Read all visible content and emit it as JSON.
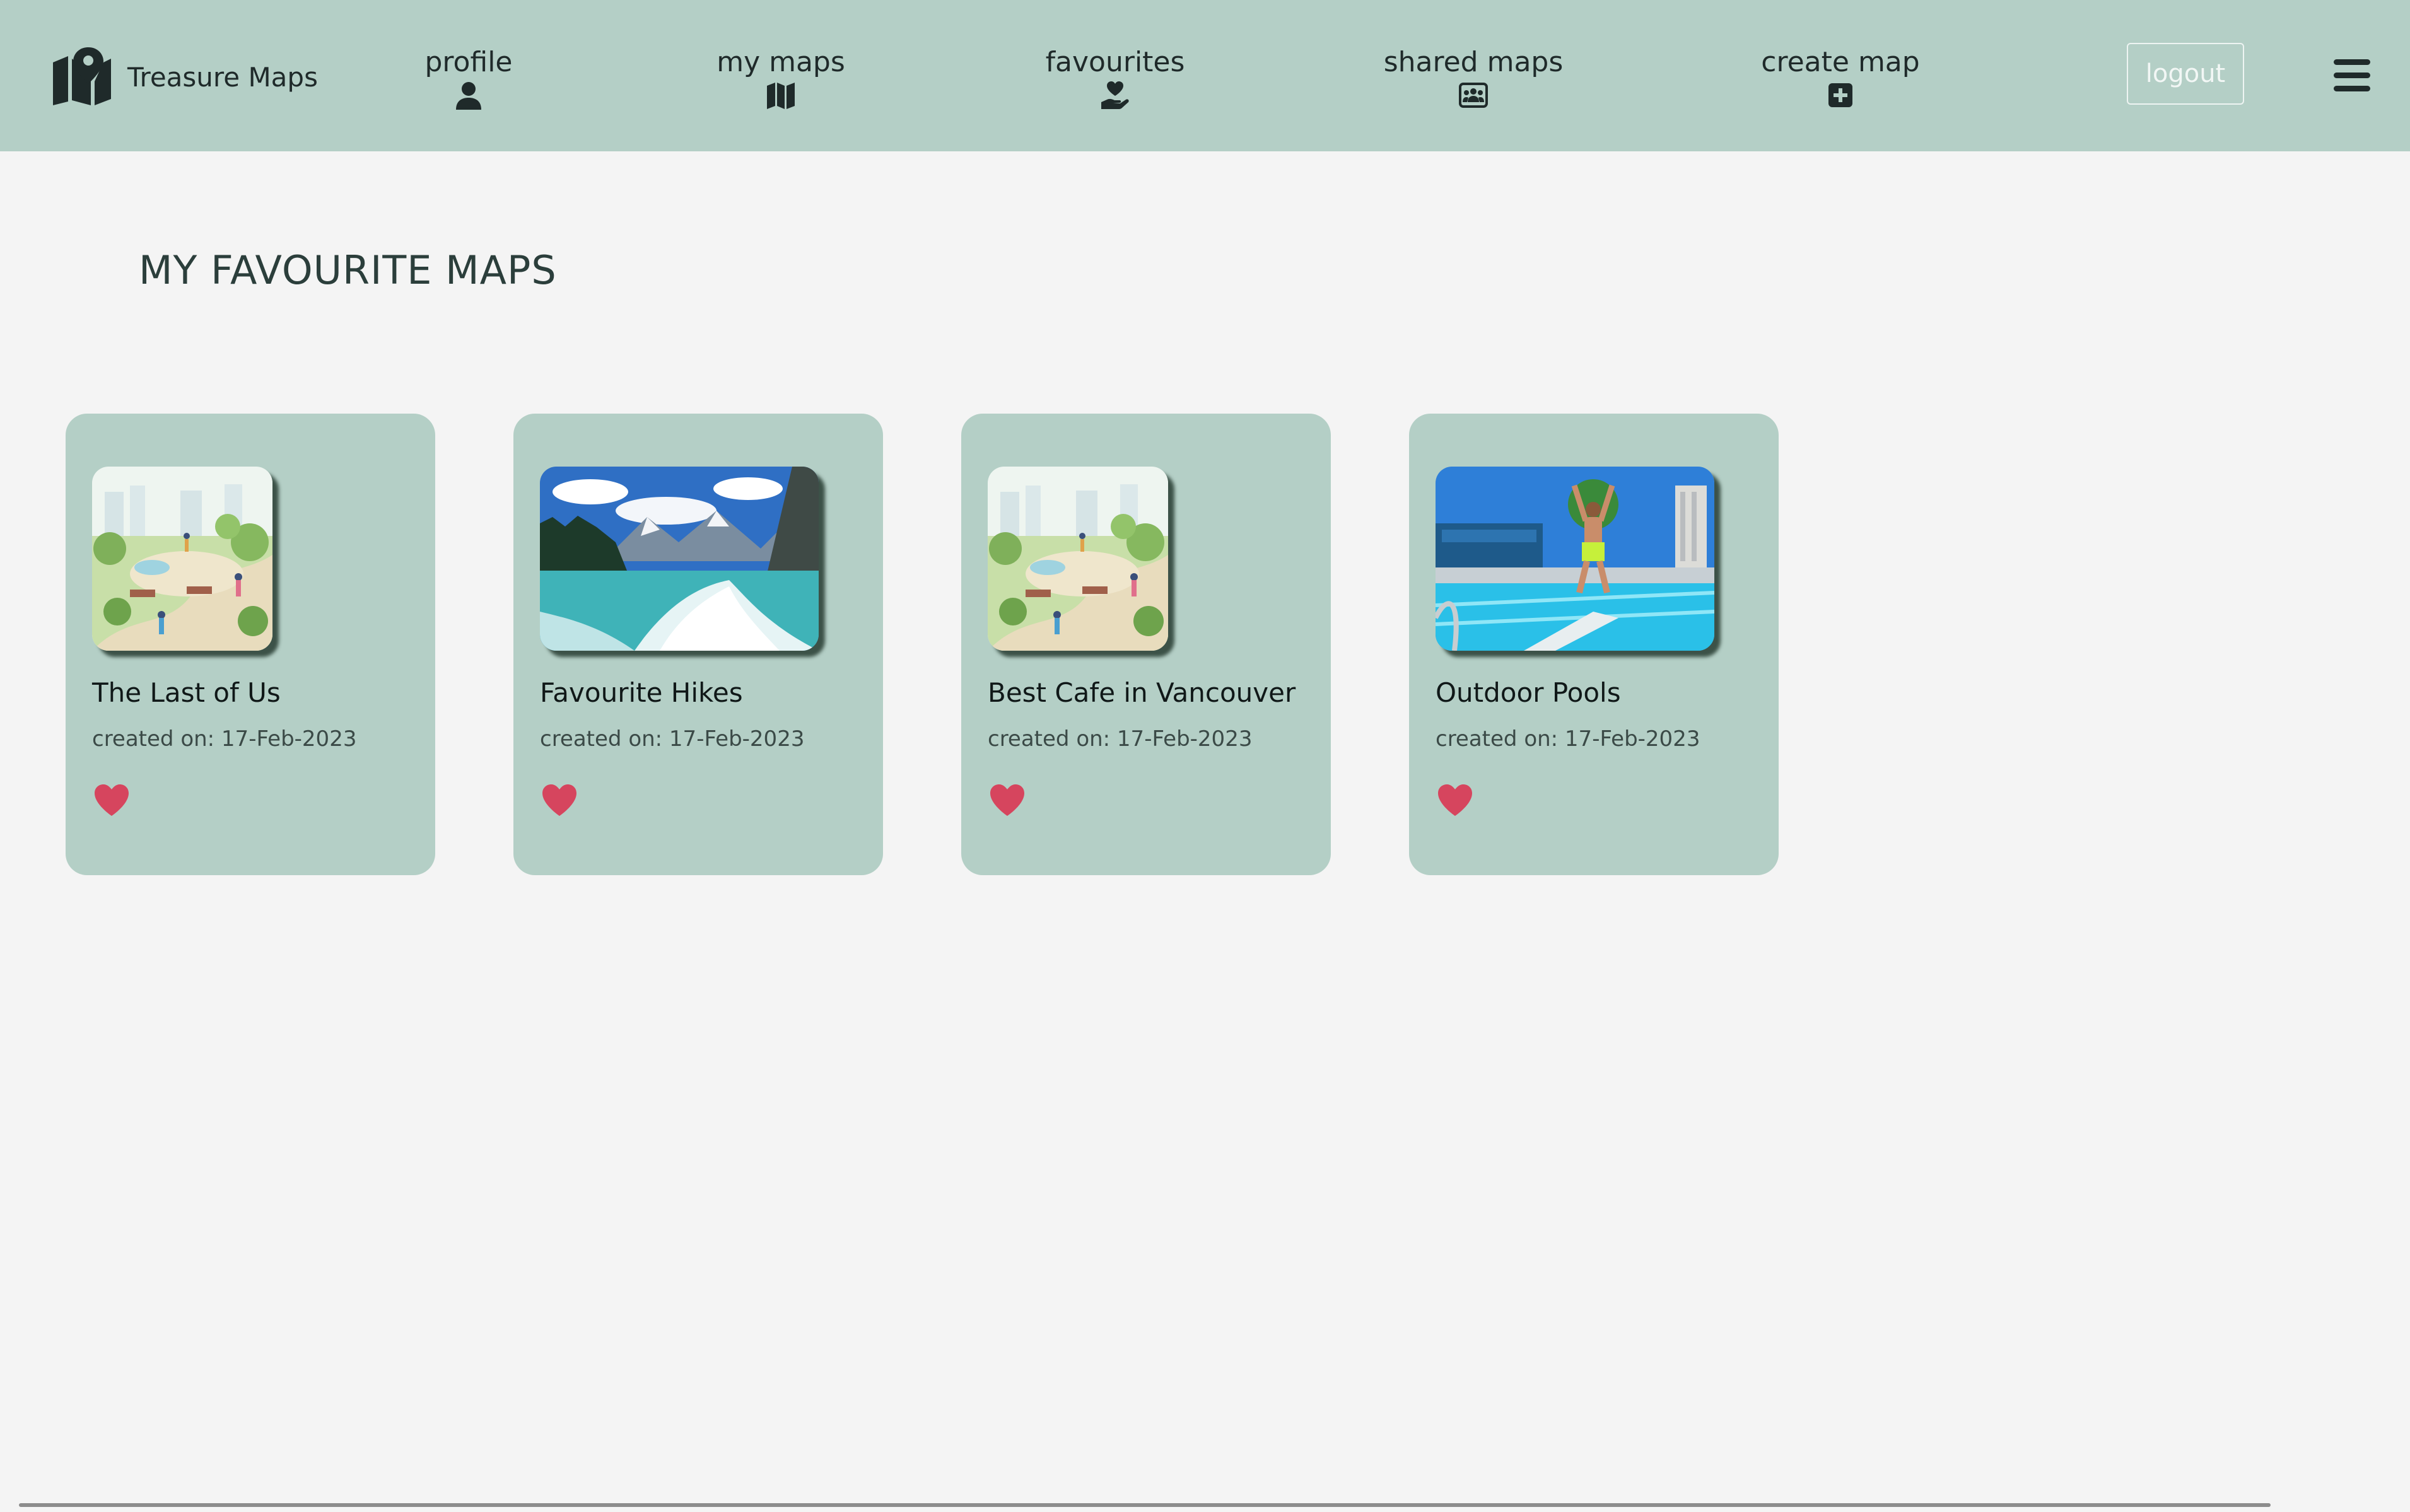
{
  "app": {
    "brand_name": "Treasure Maps",
    "brand_icon": "map-marker-icon"
  },
  "nav": {
    "items": [
      {
        "label": "profile",
        "icon": "user-icon"
      },
      {
        "label": "my maps",
        "icon": "folded-map-icon"
      },
      {
        "label": "favourites",
        "icon": "hand-heart-icon"
      },
      {
        "label": "shared maps",
        "icon": "group-card-icon"
      },
      {
        "label": "create map",
        "icon": "plus-square-icon"
      }
    ],
    "logout_label": "logout",
    "menu_icon": "hamburger-icon"
  },
  "page": {
    "title": "MY FAVOURITE MAPS"
  },
  "cards": [
    {
      "title": "The Last of Us",
      "date": "created on: 17-Feb-2023",
      "image": "park-illustration",
      "favourite": true
    },
    {
      "title": "Favourite Hikes",
      "date": "created on: 17-Feb-2023",
      "image": "mountain-lake-photo",
      "favourite": true
    },
    {
      "title": "Best Cafe in Vancouver",
      "date": "created on: 17-Feb-2023",
      "image": "park-illustration",
      "favourite": true
    },
    {
      "title": "Outdoor Pools",
      "date": "created on: 17-Feb-2023",
      "image": "pool-jump-photo",
      "favourite": true
    }
  ],
  "colors": {
    "nav_background": "#b4cfc6",
    "card_background": "#b4cfc6",
    "page_background": "#f4f4f4",
    "heart": "#d6455e",
    "title_text": "#2b3e3b"
  }
}
